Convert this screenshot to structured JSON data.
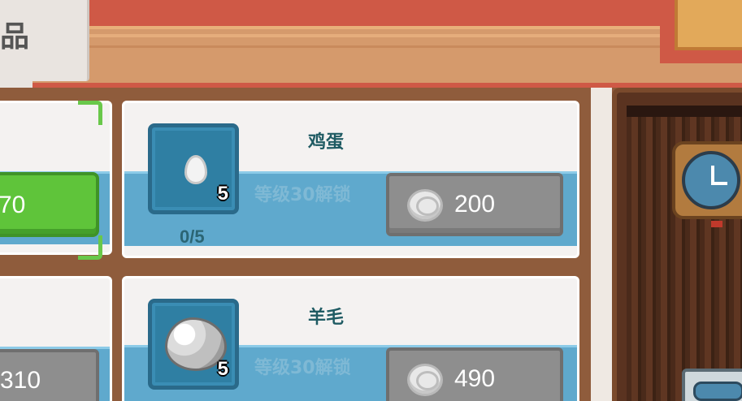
{
  "header": {
    "tab_title_partial": "品"
  },
  "left_cards": [
    {
      "price_partial": "70",
      "button_style": "green"
    },
    {
      "price_partial": "310",
      "button_style": "grey"
    }
  ],
  "items": [
    {
      "name": "鸡蛋",
      "icon": "egg-icon",
      "badge_count": "5",
      "lock_text": "等级30解锁",
      "price": "200",
      "stock": "0/5"
    },
    {
      "name": "羊毛",
      "icon": "wool-icon",
      "badge_count": "5",
      "lock_text": "等级30解锁",
      "price": "490"
    }
  ],
  "currency_icon": "silver-coin-icon",
  "colors": {
    "card_band": "#5fa9cd",
    "buy_green": "#5fc43a",
    "price_grey": "#8e8e8e",
    "item_name": "#1f5b63",
    "lock_text": "#7fb9d5",
    "banner_red": "#cf5946"
  }
}
